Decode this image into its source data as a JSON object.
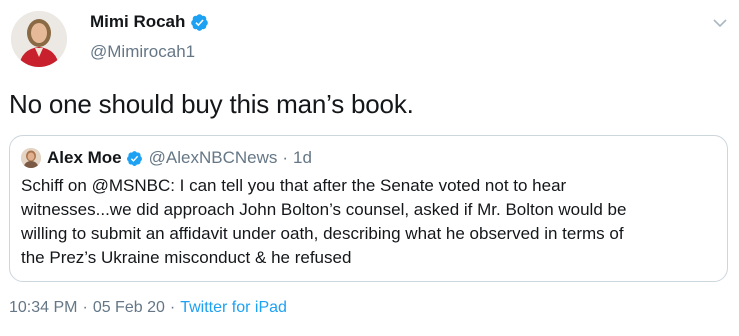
{
  "author": {
    "display_name": "Mimi Rocah",
    "handle": "@Mimirocah1",
    "verified": true
  },
  "tweet": {
    "text": "No one should buy this man’s book."
  },
  "quoted_tweet": {
    "display_name": "Alex Moe",
    "handle": "@AlexNBCNews",
    "separator": "·",
    "time": "1d",
    "verified": true,
    "lines": [
      "Schiff on @MSNBC: I can tell you that after the Senate voted not to hear",
      "witnesses...we did approach John Bolton’s counsel, asked if Mr. Bolton would be",
      "willing to submit an affidavit under oath, describing what he observed in terms of",
      "the Prez’s Ukraine misconduct & he refused"
    ]
  },
  "meta": {
    "time": "10:34 PM",
    "separator1": "·",
    "date": "05 Feb 20",
    "separator2": "·",
    "source": "Twitter for iPad"
  },
  "icons": {
    "verified": "verified-badge-icon",
    "menu": "chevron-down-icon"
  },
  "colors": {
    "text": "#14171a",
    "secondary": "#657786",
    "link": "#1da1f2",
    "border": "#ccd6dd",
    "verified": "#1da1f2"
  }
}
